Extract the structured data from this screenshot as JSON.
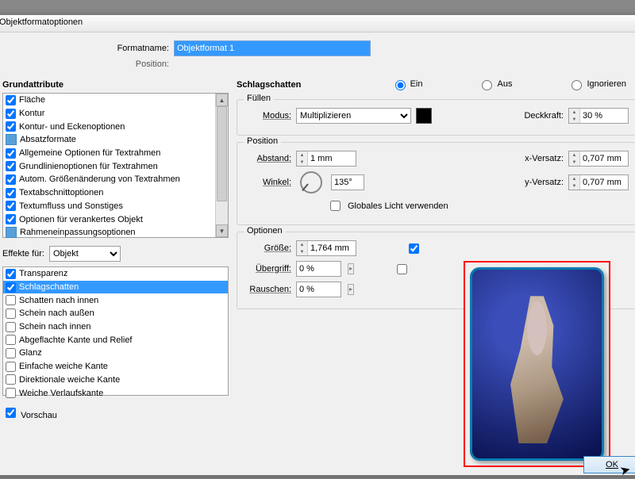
{
  "titlebar": "Objektformatoptionen",
  "top": {
    "formatname_label": "Formatname:",
    "formatname_value": "Objektformat 1",
    "position_label": "Position:"
  },
  "left": {
    "grund_title": "Grundattribute",
    "grund_items": [
      "Fläche",
      "Kontur",
      "Kontur- und Eckenoptionen",
      "Absatzformate",
      "Allgemeine Optionen für Textrahmen",
      "Grundlinienoptionen für Textrahmen",
      "Autom. Größenänderung von Textrahmen",
      "Textabschnittoptionen",
      "Textumfluss und Sonstiges",
      "Optionen für verankertes Objekt",
      "Rahmeneinpassungsoptionen"
    ],
    "effects_label": "Effekte für:",
    "effects_value": "Objekt",
    "eff_items": [
      "Transparenz",
      "Schlagschatten",
      "Schatten nach innen",
      "Schein nach außen",
      "Schein nach innen",
      "Abgeflachte Kante und Relief",
      "Glanz",
      "Einfache weiche Kante",
      "Direktionale weiche Kante",
      "Weiche Verlaufskante"
    ],
    "vorschau": "Vorschau"
  },
  "right": {
    "heading": "Schlagschatten",
    "radio": {
      "ein": "Ein",
      "aus": "Aus",
      "ignorieren": "Ignorieren"
    },
    "fill": {
      "legend": "Füllen",
      "modus_label": "Modus:",
      "modus_value": "Multiplizieren",
      "deck_label": "Deckkraft:",
      "deck_value": "30 %"
    },
    "pos": {
      "legend": "Position",
      "abstand_label": "Abstand:",
      "abstand_value": "1 mm",
      "winkel_label": "Winkel:",
      "winkel_value": "135°",
      "xvers_label": "x-Versatz:",
      "xvers_value": "0,707 mm",
      "yvers_label": "y-Versatz:",
      "yvers_value": "0,707 mm",
      "global": "Globales Licht verwenden"
    },
    "opt": {
      "legend": "Optionen",
      "groesse_label": "Größe:",
      "groesse_value": "1,764 mm",
      "ueber_label": "Übergriff:",
      "ueber_value": "0 %",
      "rausch_label": "Rauschen:",
      "rausch_value": "0 %"
    }
  },
  "ok": "OK"
}
